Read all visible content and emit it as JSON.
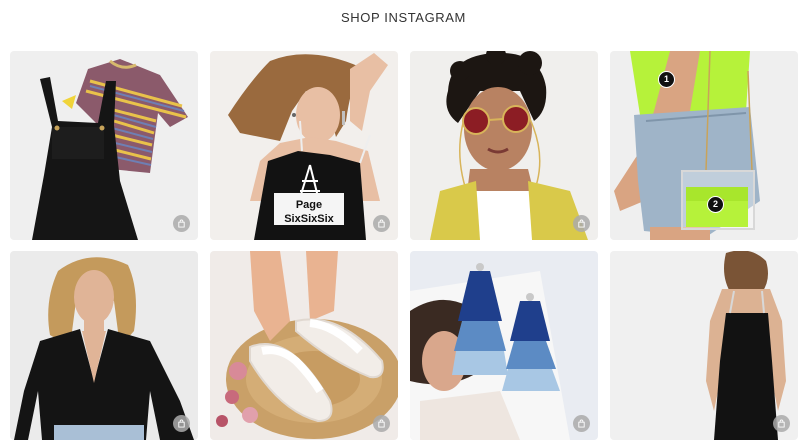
{
  "header": {
    "title": "SHOP INSTAGRAM"
  },
  "tiles": [
    {
      "id": "overall-stripe-tee",
      "text": "",
      "icon": "shopping-bag-icon"
    },
    {
      "id": "lace-up-cami",
      "text": "PageSixSixSix",
      "icon": "shopping-bag-icon"
    },
    {
      "id": "round-sunglasses",
      "text": "",
      "icon": "shopping-bag-icon"
    },
    {
      "id": "neon-clutch",
      "text": "",
      "icon": "shopping-bag-icon",
      "hotspots": [
        "1",
        "2"
      ]
    },
    {
      "id": "black-cardigan",
      "text": "",
      "icon": "shopping-bag-icon"
    },
    {
      "id": "scallop-sandals",
      "text": "",
      "icon": "shopping-bag-icon"
    },
    {
      "id": "tassel-earrings",
      "text": "",
      "icon": "shopping-bag-icon"
    },
    {
      "id": "black-cami-dress",
      "text": "",
      "icon": "shopping-bag-icon"
    }
  ],
  "colors": {
    "bag_icon": "#aaaaaa",
    "background": "#ffffff",
    "neon": "#b6f23a"
  }
}
